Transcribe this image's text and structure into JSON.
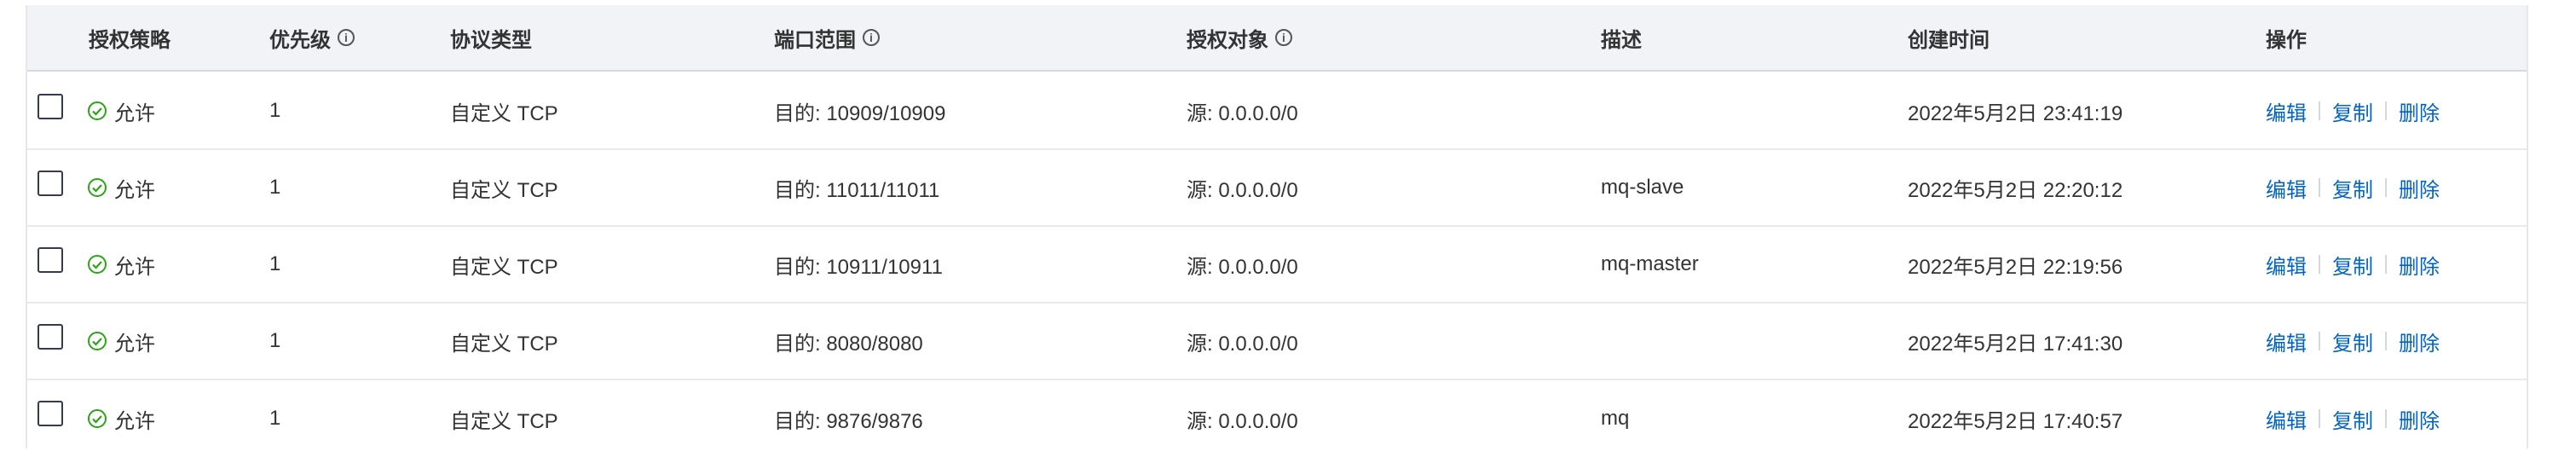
{
  "table": {
    "columns": {
      "policy": "授权策略",
      "priority": "优先级",
      "protocol": "协议类型",
      "port_range": "端口范围",
      "auth_object": "授权对象",
      "description": "描述",
      "created": "创建时间",
      "actions": "操作"
    },
    "action_labels": {
      "edit": "编辑",
      "copy": "复制",
      "delete": "删除"
    },
    "rows": [
      {
        "policy": "允许",
        "priority": "1",
        "protocol": "自定义 TCP",
        "port_range": "目的: 10909/10909",
        "auth_object": "源: 0.0.0.0/0",
        "description": "",
        "created": "2022年5月2日 23:41:19"
      },
      {
        "policy": "允许",
        "priority": "1",
        "protocol": "自定义 TCP",
        "port_range": "目的: 11011/11011",
        "auth_object": "源: 0.0.0.0/0",
        "description": "mq-slave",
        "created": "2022年5月2日 22:20:12"
      },
      {
        "policy": "允许",
        "priority": "1",
        "protocol": "自定义 TCP",
        "port_range": "目的: 10911/10911",
        "auth_object": "源: 0.0.0.0/0",
        "description": "mq-master",
        "created": "2022年5月2日 22:19:56"
      },
      {
        "policy": "允许",
        "priority": "1",
        "protocol": "自定义 TCP",
        "port_range": "目的: 8080/8080",
        "auth_object": "源: 0.0.0.0/0",
        "description": "",
        "created": "2022年5月2日 17:41:30"
      },
      {
        "policy": "允许",
        "priority": "1",
        "protocol": "自定义 TCP",
        "port_range": "目的: 9876/9876",
        "auth_object": "源: 0.0.0.0/0",
        "description": "mq",
        "created": "2022年5月2日 17:40:57"
      }
    ]
  },
  "colors": {
    "allow_green": "#2aa515",
    "link_blue": "#0064c8",
    "header_bg": "#f1f3f7"
  },
  "icons": {
    "info": "info-circle-icon",
    "allow": "check-circle-icon"
  }
}
